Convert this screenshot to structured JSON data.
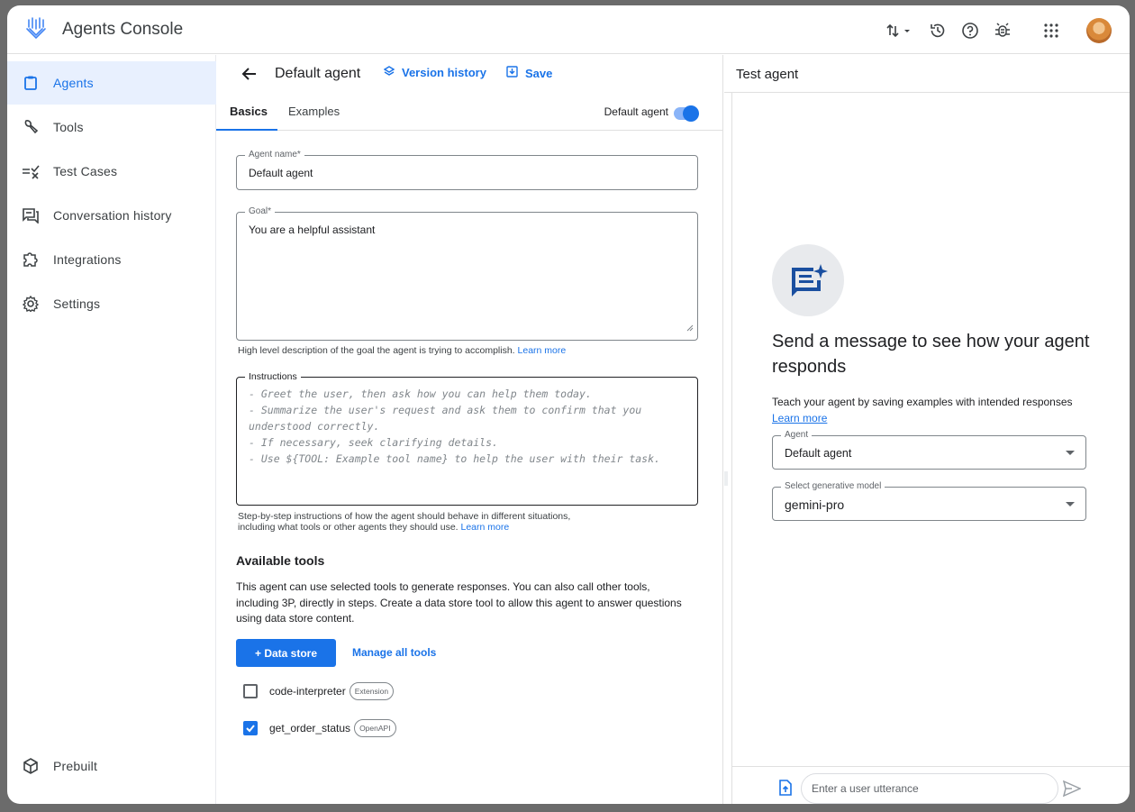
{
  "app": {
    "title": "Agents Console"
  },
  "sidebar": {
    "items": [
      {
        "label": "Agents",
        "icon": "clipboard-icon"
      },
      {
        "label": "Tools",
        "icon": "wrench-icon"
      },
      {
        "label": "Test Cases",
        "icon": "checklist-icon"
      },
      {
        "label": "Conversation history",
        "icon": "chat-history-icon"
      },
      {
        "label": "Integrations",
        "icon": "puzzle-icon"
      },
      {
        "label": "Settings",
        "icon": "gear-icon"
      }
    ],
    "bottom": {
      "label": "Prebuilt",
      "icon": "cube-icon"
    }
  },
  "agent": {
    "title": "Default agent",
    "version_history": "Version history",
    "save": "Save",
    "tabs": [
      "Basics",
      "Examples"
    ],
    "toggle_label": "Default agent",
    "name_label": "Agent name*",
    "name_value": "Default agent",
    "goal_label": "Goal*",
    "goal_value": "You are a helpful assistant",
    "goal_helper": "High level description of the goal the agent is trying to accomplish.",
    "learn_more": "Learn more",
    "instructions_label": "Instructions",
    "instructions_lines": [
      "- Greet the user, then ask how you can help them today.",
      "- Summarize the user's request and ask them to confirm that you",
      "understood correctly.",
      "- If necessary, seek clarifying details.",
      "- Use ${TOOL: Example tool name} to help the user with their task."
    ],
    "instructions_helper_1": "Step-by-step instructions of how the agent should behave in different situations,",
    "instructions_helper_2": "including what tools or other agents they should use.",
    "tools_title": "Available tools",
    "tools_desc": "This agent can use selected tools to generate responses. You can also call other tools, including 3P, directly in steps. Create a data store tool to allow this agent to answer questions using data store content.",
    "data_store_button": "+ Data store",
    "manage_tools": "Manage all tools",
    "tools": [
      {
        "name": "code-interpreter",
        "type": "Extension",
        "checked": false
      },
      {
        "name": "get_order_status",
        "type": "OpenAPI",
        "checked": true
      }
    ]
  },
  "test_agent": {
    "title": "Test agent",
    "heading": "Send a message to see how your agent responds",
    "desc": "Teach your agent by saving examples with intended responses",
    "learn_more": "Learn more",
    "agent_label": "Agent",
    "agent_value": "Default agent",
    "model_label": "Select generative model",
    "model_value": "gemini-pro",
    "input_placeholder": "Enter a user utterance"
  },
  "colors": {
    "accent": "#1a73e8",
    "active_bg": "#e8f0fe"
  }
}
